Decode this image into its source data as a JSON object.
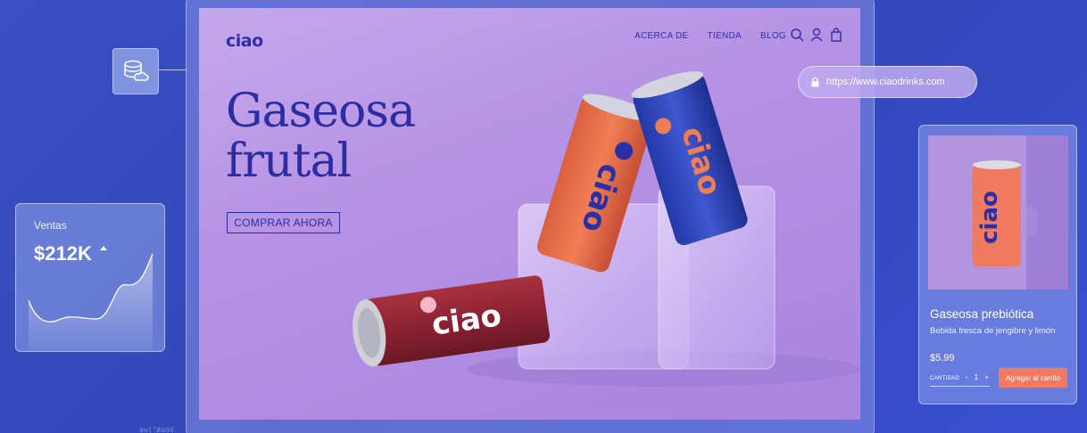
{
  "site": {
    "logo": "ciao",
    "nav": [
      "ACERCA DE",
      "TIENDA",
      "BLOG"
    ],
    "hero_line1": "Gaseosa",
    "hero_line2": "frutal",
    "cta": "COMPRAR AHORA",
    "can_text": "ciao"
  },
  "url_pill": {
    "url": "https://www.ciaodrinks.com"
  },
  "sales_card": {
    "label": "Ventas",
    "value": "$212K",
    "trend": "up"
  },
  "product_card": {
    "name": "Gaseosa prebiótica",
    "description": "Bebida fresca de jengibre y limón",
    "price": "$5.99",
    "qty_label": "CANTIDAD",
    "qty_minus": "-",
    "qty_value": "1",
    "qty_plus": "+",
    "add_button": "Agregar al carrito",
    "can_text": "ciao"
  },
  "code_hint": "$w(\"#add",
  "colors": {
    "brand": "#2c2da3",
    "accent": "#f07a5f",
    "background": "#3a4fc4"
  }
}
